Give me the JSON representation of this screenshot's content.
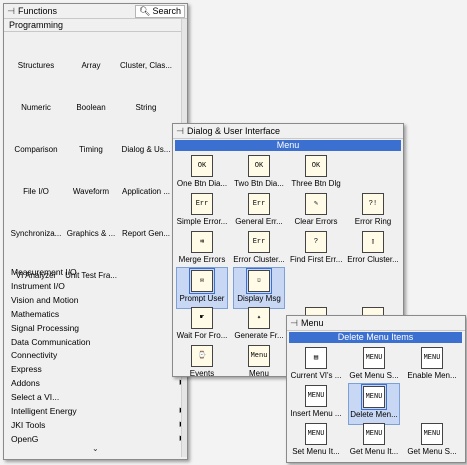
{
  "functions_palette": {
    "title": "Functions",
    "search_label": "Search",
    "programming_label": "Programming",
    "icons": [
      {
        "label": "Structures",
        "icon": "structures-icon"
      },
      {
        "label": "Array",
        "icon": "array-icon"
      },
      {
        "label": "Cluster, Clas...",
        "icon": "cluster-icon"
      },
      {
        "label": "Numeric",
        "icon": "numeric-icon"
      },
      {
        "label": "Boolean",
        "icon": "boolean-icon"
      },
      {
        "label": "String",
        "icon": "string-icon"
      },
      {
        "label": "Comparison",
        "icon": "comparison-icon"
      },
      {
        "label": "Timing",
        "icon": "timing-icon"
      },
      {
        "label": "Dialog & Us...",
        "icon": "dialog-icon"
      },
      {
        "label": "File I/O",
        "icon": "file-io-icon"
      },
      {
        "label": "Waveform",
        "icon": "waveform-icon"
      },
      {
        "label": "Application ...",
        "icon": "application-icon"
      },
      {
        "label": "Synchroniza...",
        "icon": "synchronization-icon"
      },
      {
        "label": "Graphics & ...",
        "icon": "graphics-icon"
      },
      {
        "label": "Report Gen...",
        "icon": "report-gen-icon"
      },
      {
        "label": "VI Analyzer",
        "icon": "vi-analyzer-icon"
      },
      {
        "label": "Unit Test Fra...",
        "icon": "unit-test-icon"
      }
    ],
    "categories": [
      "Measurement I/O",
      "Instrument I/O",
      "Vision and Motion",
      "Mathematics",
      "Signal Processing",
      "Data Communication",
      "Connectivity",
      "Express",
      "Addons",
      "Select a VI...",
      "Intelligent Energy",
      "JKI Tools",
      "OpenG"
    ],
    "more_chevron": "⌄"
  },
  "dialog_palette": {
    "title": "Dialog & User Interface",
    "menu_header": "Menu",
    "icons": [
      {
        "label": "One Btn Dia...",
        "icon": "one-button-dialog-icon",
        "glyph": "OK"
      },
      {
        "label": "Two Btn Dia...",
        "icon": "two-button-dialog-icon",
        "glyph": "OK"
      },
      {
        "label": "Three Btn Dlg",
        "icon": "three-button-dialog-icon",
        "glyph": "OK"
      },
      {
        "label": "",
        "icon": "blank-icon",
        "glyph": ""
      },
      {
        "label": "Simple Error...",
        "icon": "simple-error-icon",
        "glyph": "Err"
      },
      {
        "label": "General Err...",
        "icon": "general-error-icon",
        "glyph": "Err"
      },
      {
        "label": "Clear Errors",
        "icon": "clear-errors-icon",
        "glyph": "✎"
      },
      {
        "label": "Error Ring",
        "icon": "error-ring-icon",
        "glyph": "?!"
      },
      {
        "label": "Merge Errors",
        "icon": "merge-errors-icon",
        "glyph": "⇉"
      },
      {
        "label": "Error Cluster...",
        "icon": "error-cluster-icon",
        "glyph": "Err"
      },
      {
        "label": "Find First Err...",
        "icon": "find-first-error-icon",
        "glyph": "?"
      },
      {
        "label": "Error Cluster...",
        "icon": "error-cluster-alt-icon",
        "glyph": "▯"
      },
      {
        "label": "Prompt User",
        "icon": "prompt-user-icon",
        "glyph": "✉"
      },
      {
        "label": "Display Msg",
        "icon": "display-msg-icon",
        "glyph": "☺"
      },
      {
        "label": "",
        "icon": "blank2-icon",
        "glyph": ""
      },
      {
        "label": "",
        "icon": "blank3-icon",
        "glyph": ""
      },
      {
        "label": "Wait For Fro...",
        "icon": "wait-for-front-icon",
        "glyph": "☛"
      },
      {
        "label": "Generate Fr...",
        "icon": "generate-front-icon",
        "glyph": "✦"
      },
      {
        "label": "",
        "icon": "cursor-icon",
        "glyph": "◎"
      },
      {
        "label": "",
        "icon": "checkbox-icon",
        "glyph": "☑"
      },
      {
        "label": "Events",
        "icon": "events-icon",
        "glyph": "⌚"
      },
      {
        "label": "Menu",
        "icon": "menu-icon",
        "glyph": "Menu"
      }
    ]
  },
  "menu_palette": {
    "title": "Menu",
    "header": "Delete Menu Items",
    "icons": [
      {
        "label": "Current VI's ...",
        "icon": "current-vi-menubar-icon",
        "glyph": "▤"
      },
      {
        "label": "Get Menu S...",
        "icon": "get-menu-selection-icon",
        "glyph": "MENU"
      },
      {
        "label": "Enable Men...",
        "icon": "enable-menu-tracking-icon",
        "glyph": "MENU"
      },
      {
        "label": "Insert Menu ...",
        "icon": "insert-menu-items-icon",
        "glyph": "MENU"
      },
      {
        "label": "Delete Men...",
        "icon": "delete-menu-items-icon",
        "glyph": "MENU"
      },
      {
        "label": "",
        "icon": "blank4-icon",
        "glyph": ""
      },
      {
        "label": "Set Menu It...",
        "icon": "set-menu-item-info-icon",
        "glyph": "MENU"
      },
      {
        "label": "Get Menu It...",
        "icon": "get-menu-item-info-icon",
        "glyph": "MENU"
      },
      {
        "label": "Get Menu S...",
        "icon": "get-menu-short-icon",
        "glyph": "MENU"
      }
    ]
  }
}
